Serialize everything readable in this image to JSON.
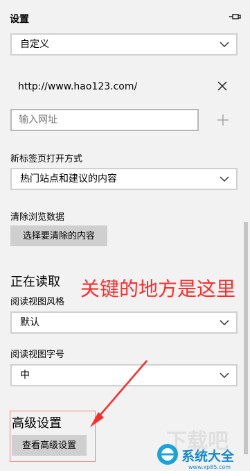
{
  "header": {
    "title": "设置",
    "pin_icon": "pin-icon"
  },
  "homepage": {
    "select_value": "自定义"
  },
  "custom_page": {
    "url": "http://www.hao123.com/",
    "input_placeholder": "输入网址"
  },
  "new_tab": {
    "label": "新标签页打开方式",
    "select_value": "热门站点和建议的内容"
  },
  "clear_data": {
    "label": "清除浏览数据",
    "button_label": "选择要清除的内容"
  },
  "reading": {
    "heading": "正在读取",
    "style_label": "阅读视图风格",
    "style_value": "默认",
    "font_label": "阅读视图字号",
    "font_value": "中"
  },
  "advanced": {
    "heading": "高级设置",
    "button_label": "查看高级设置"
  },
  "annotation": {
    "text": "关键的地方是这里",
    "color": "#ff2b2b"
  },
  "watermark": {
    "brand": "系统大全",
    "domain": "www.xp85.com"
  }
}
